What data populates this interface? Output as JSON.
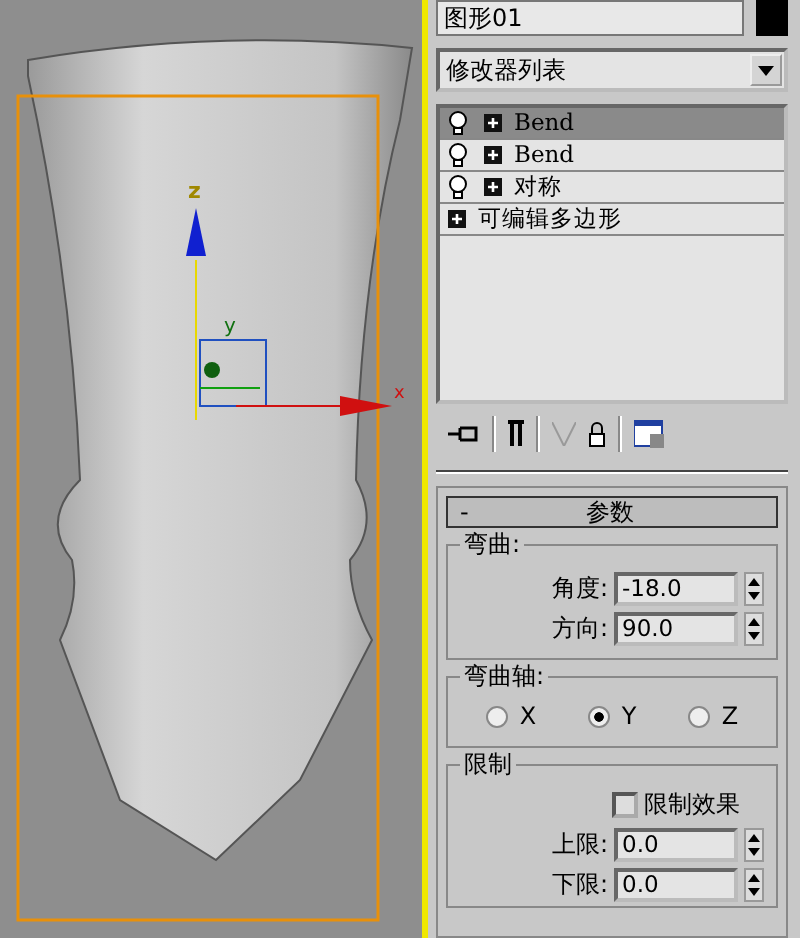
{
  "viewport": {
    "gizmo_labels": [
      "z",
      "y",
      "x"
    ]
  },
  "object_name": "图形01",
  "modifier_list": {
    "label": "修改器列表"
  },
  "modifier_stack": [
    {
      "label": "Bend",
      "kind": "modifier",
      "selected": true
    },
    {
      "label": "Bend",
      "kind": "modifier",
      "selected": false
    },
    {
      "label": "对称",
      "kind": "modifier",
      "selected": false
    },
    {
      "label": "可编辑多边形",
      "kind": "base",
      "selected": false
    }
  ],
  "rollout": {
    "toggle": "-",
    "title": "参数"
  },
  "bend": {
    "title": "弯曲:",
    "fields": [
      {
        "label": "角度:",
        "value": "-18.0"
      },
      {
        "label": "方向:",
        "value": "90.0"
      }
    ]
  },
  "bend_axis": {
    "title": "弯曲轴:",
    "options": [
      {
        "label": "X",
        "selected": false
      },
      {
        "label": "Y",
        "selected": true
      },
      {
        "label": "Z",
        "selected": false
      }
    ]
  },
  "limits": {
    "title": "限制",
    "checkbox": {
      "label": "限制效果",
      "checked": false
    },
    "fields": [
      {
        "label": "上限:",
        "value": "0.0"
      },
      {
        "label": "下限:",
        "value": "0.0"
      }
    ]
  }
}
